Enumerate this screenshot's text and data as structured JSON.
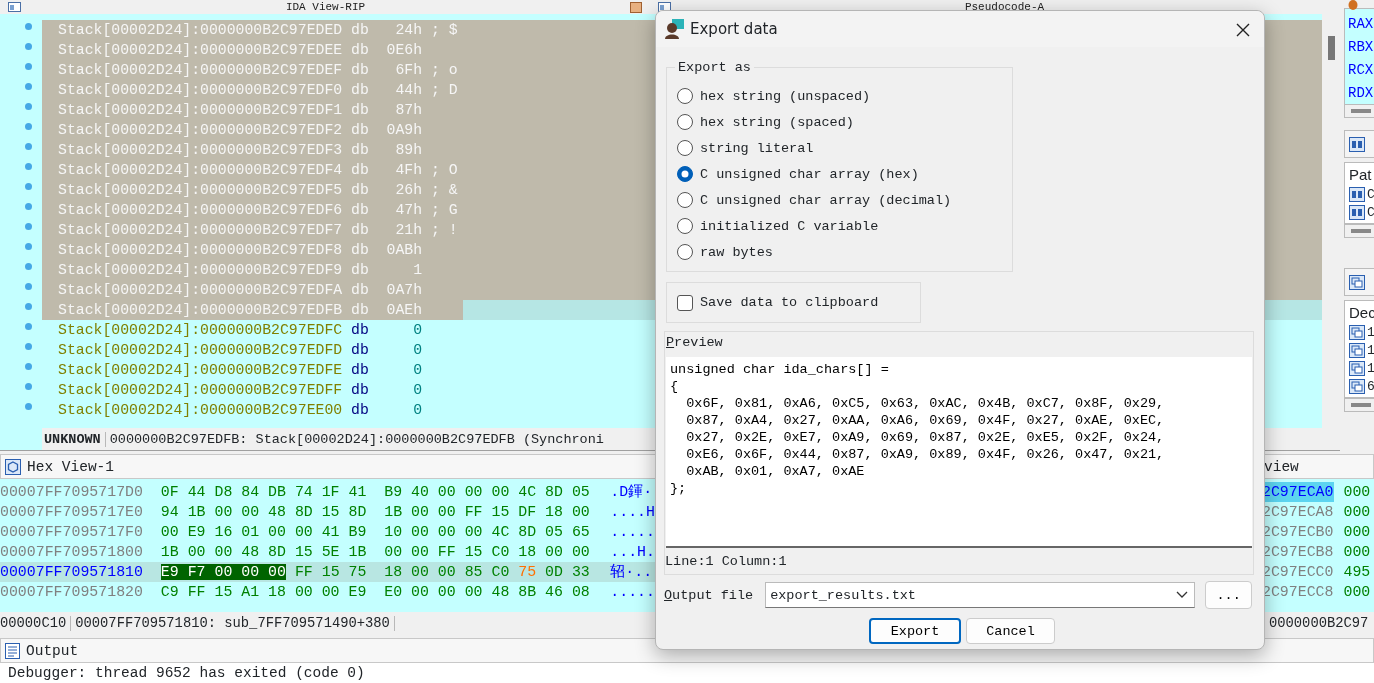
{
  "ida_view": {
    "title": "IDA View-RIP",
    "lines": [
      {
        "address": "Stack[00002D24]:0000000B2C97EDED",
        "op": "db",
        "value": "24h",
        "comment": "; $",
        "selected": true,
        "current": false
      },
      {
        "address": "Stack[00002D24]:0000000B2C97EDEE",
        "op": "db",
        "value": "0E6h",
        "selected": true,
        "current": false
      },
      {
        "address": "Stack[00002D24]:0000000B2C97EDEF",
        "op": "db",
        "value": "6Fh",
        "comment": "; o",
        "selected": true,
        "current": false
      },
      {
        "address": "Stack[00002D24]:0000000B2C97EDF0",
        "op": "db",
        "value": "44h",
        "comment": "; D",
        "selected": true,
        "current": false
      },
      {
        "address": "Stack[00002D24]:0000000B2C97EDF1",
        "op": "db",
        "value": "87h",
        "selected": true,
        "current": false
      },
      {
        "address": "Stack[00002D24]:0000000B2C97EDF2",
        "op": "db",
        "value": "0A9h",
        "selected": true,
        "current": false
      },
      {
        "address": "Stack[00002D24]:0000000B2C97EDF3",
        "op": "db",
        "value": "89h",
        "selected": true,
        "current": false
      },
      {
        "address": "Stack[00002D24]:0000000B2C97EDF4",
        "op": "db",
        "value": "4Fh",
        "comment": "; O",
        "selected": true,
        "current": false
      },
      {
        "address": "Stack[00002D24]:0000000B2C97EDF5",
        "op": "db",
        "value": "26h",
        "comment": "; &",
        "selected": true,
        "current": false
      },
      {
        "address": "Stack[00002D24]:0000000B2C97EDF6",
        "op": "db",
        "value": "47h",
        "comment": "; G",
        "selected": true,
        "current": false
      },
      {
        "address": "Stack[00002D24]:0000000B2C97EDF7",
        "op": "db",
        "value": "21h",
        "comment": "; !",
        "selected": true,
        "current": false
      },
      {
        "address": "Stack[00002D24]:0000000B2C97EDF8",
        "op": "db",
        "value": "0ABh",
        "selected": true,
        "current": false
      },
      {
        "address": "Stack[00002D24]:0000000B2C97EDF9",
        "op": "db",
        "value": "1",
        "selected": true,
        "current": false
      },
      {
        "address": "Stack[00002D24]:0000000B2C97EDFA",
        "op": "db",
        "value": "0A7h",
        "selected": true,
        "current": false
      },
      {
        "address": "Stack[00002D24]:0000000B2C97EDFB",
        "op": "db",
        "value": "0AEh",
        "selected": false,
        "current": true
      },
      {
        "address": "Stack[00002D24]:0000000B2C97EDFC",
        "op": "db",
        "value": "0",
        "selected": false,
        "current": false
      },
      {
        "address": "Stack[00002D24]:0000000B2C97EDFD",
        "op": "db",
        "value": "0",
        "selected": false,
        "current": false
      },
      {
        "address": "Stack[00002D24]:0000000B2C97EDFE",
        "op": "db",
        "value": "0",
        "selected": false,
        "current": false
      },
      {
        "address": "Stack[00002D24]:0000000B2C97EDFF",
        "op": "db",
        "value": "0",
        "selected": false,
        "current": false
      },
      {
        "address": "Stack[00002D24]:0000000B2C97EE00",
        "op": "db",
        "value": "0",
        "selected": false,
        "current": false
      }
    ],
    "status_kind": "UNKNOWN",
    "status_text": "0000000B2C97EDFB: Stack[00002D24]:0000000B2C97EDFB (Synchroni"
  },
  "pseudocode_tab": {
    "title": "Pseudocode-A"
  },
  "right_panels": {
    "registers": [
      "RAX",
      "RBX",
      "RCX",
      "RDX"
    ],
    "panel_2": {
      "header": "Pat",
      "items": [
        "C",
        "C"
      ]
    },
    "panel_3": {
      "header": "Dec",
      "items": [
        "1",
        "1",
        "1",
        "6"
      ]
    }
  },
  "hex_view": {
    "title": "Hex View-1",
    "rows": [
      {
        "address": "00007FF7095717D0",
        "selected": false,
        "ascii": ".D鍕·",
        "bytes": [
          {
            "text": "0F",
            "kind": "plain"
          },
          {
            "text": "44",
            "kind": "plain"
          },
          {
            "text": "D8",
            "kind": "plain"
          },
          {
            "text": "84",
            "kind": "plain"
          },
          {
            "text": "DB",
            "kind": "plain"
          },
          {
            "text": "74",
            "kind": "plain"
          },
          {
            "text": "1F",
            "kind": "plain"
          },
          {
            "text": "41",
            "kind": "plain"
          },
          {
            "text": "B9",
            "kind": "plain"
          },
          {
            "text": "40",
            "kind": "plain"
          },
          {
            "text": "00",
            "kind": "plain"
          },
          {
            "text": "00",
            "kind": "plain"
          },
          {
            "text": "00",
            "kind": "plain"
          },
          {
            "text": "4C",
            "kind": "plain"
          },
          {
            "text": "8D",
            "kind": "plain"
          },
          {
            "text": "05",
            "kind": "plain"
          }
        ]
      },
      {
        "address": "00007FF7095717E0",
        "selected": false,
        "ascii": "....H",
        "bytes": [
          {
            "text": "94",
            "kind": "plain"
          },
          {
            "text": "1B",
            "kind": "plain"
          },
          {
            "text": "00",
            "kind": "plain"
          },
          {
            "text": "00",
            "kind": "plain"
          },
          {
            "text": "48",
            "kind": "plain"
          },
          {
            "text": "8D",
            "kind": "plain"
          },
          {
            "text": "15",
            "kind": "plain"
          },
          {
            "text": "8D",
            "kind": "plain"
          },
          {
            "text": "1B",
            "kind": "plain"
          },
          {
            "text": "00",
            "kind": "plain"
          },
          {
            "text": "00",
            "kind": "plain"
          },
          {
            "text": "FF",
            "kind": "plain"
          },
          {
            "text": "15",
            "kind": "plain"
          },
          {
            "text": "DF",
            "kind": "plain"
          },
          {
            "text": "18",
            "kind": "plain"
          },
          {
            "text": "00",
            "kind": "plain"
          }
        ]
      },
      {
        "address": "00007FF7095717F0",
        "selected": false,
        "ascii": ".....",
        "bytes": [
          {
            "text": "00",
            "kind": "plain"
          },
          {
            "text": "E9",
            "kind": "plain"
          },
          {
            "text": "16",
            "kind": "plain"
          },
          {
            "text": "01",
            "kind": "plain"
          },
          {
            "text": "00",
            "kind": "plain"
          },
          {
            "text": "00",
            "kind": "plain"
          },
          {
            "text": "41",
            "kind": "plain"
          },
          {
            "text": "B9",
            "kind": "plain"
          },
          {
            "text": "10",
            "kind": "plain"
          },
          {
            "text": "00",
            "kind": "plain"
          },
          {
            "text": "00",
            "kind": "plain"
          },
          {
            "text": "00",
            "kind": "plain"
          },
          {
            "text": "4C",
            "kind": "plain"
          },
          {
            "text": "8D",
            "kind": "plain"
          },
          {
            "text": "05",
            "kind": "plain"
          },
          {
            "text": "65",
            "kind": "plain"
          }
        ]
      },
      {
        "address": "00007FF709571800",
        "selected": false,
        "ascii": "...H.",
        "bytes": [
          {
            "text": "1B",
            "kind": "plain"
          },
          {
            "text": "00",
            "kind": "plain"
          },
          {
            "text": "00",
            "kind": "plain"
          },
          {
            "text": "48",
            "kind": "plain"
          },
          {
            "text": "8D",
            "kind": "plain"
          },
          {
            "text": "15",
            "kind": "plain"
          },
          {
            "text": "5E",
            "kind": "plain"
          },
          {
            "text": "1B",
            "kind": "plain"
          },
          {
            "text": "00",
            "kind": "plain"
          },
          {
            "text": "00",
            "kind": "plain"
          },
          {
            "text": "FF",
            "kind": "plain"
          },
          {
            "text": "15",
            "kind": "plain"
          },
          {
            "text": "C0",
            "kind": "plain"
          },
          {
            "text": "18",
            "kind": "plain"
          },
          {
            "text": "00",
            "kind": "plain"
          },
          {
            "text": "00",
            "kind": "plain"
          }
        ]
      },
      {
        "address": "00007FF709571810",
        "selected": true,
        "ascii": "轺·..",
        "bytes": [
          {
            "text": "E9",
            "kind": "selected"
          },
          {
            "text": "F7",
            "kind": "selected"
          },
          {
            "text": "00",
            "kind": "selected"
          },
          {
            "text": "00",
            "kind": "selected"
          },
          {
            "text": "00",
            "kind": "selected"
          },
          {
            "text": "FF",
            "kind": "plain"
          },
          {
            "text": "15",
            "kind": "plain"
          },
          {
            "text": "75",
            "kind": "plain"
          },
          {
            "text": "18",
            "kind": "plain"
          },
          {
            "text": "00",
            "kind": "plain"
          },
          {
            "text": "00",
            "kind": "plain"
          },
          {
            "text": "85",
            "kind": "plain"
          },
          {
            "text": "C0",
            "kind": "plain"
          },
          {
            "text": "75",
            "kind": "changed"
          },
          {
            "text": "0D",
            "kind": "plain"
          },
          {
            "text": "33",
            "kind": "plain"
          }
        ]
      },
      {
        "address": "00007FF709571820",
        "selected": false,
        "ascii": ".....",
        "bytes": [
          {
            "text": "C9",
            "kind": "plain"
          },
          {
            "text": "FF",
            "kind": "plain"
          },
          {
            "text": "15",
            "kind": "plain"
          },
          {
            "text": "A1",
            "kind": "plain"
          },
          {
            "text": "18",
            "kind": "plain"
          },
          {
            "text": "00",
            "kind": "plain"
          },
          {
            "text": "00",
            "kind": "plain"
          },
          {
            "text": "E9",
            "kind": "plain"
          },
          {
            "text": "E0",
            "kind": "plain"
          },
          {
            "text": "00",
            "kind": "plain"
          },
          {
            "text": "00",
            "kind": "plain"
          },
          {
            "text": "00",
            "kind": "plain"
          },
          {
            "text": "48",
            "kind": "plain"
          },
          {
            "text": "8B",
            "kind": "plain"
          },
          {
            "text": "46",
            "kind": "plain"
          },
          {
            "text": "08",
            "kind": "plain"
          }
        ]
      }
    ],
    "status_offset": "00000C10",
    "status_text": "00007FF709571810: sub_7FF709571490+380"
  },
  "hex_view_2": {
    "title": "view",
    "rows": [
      {
        "address": "2C97ECA0",
        "value": "000",
        "selected": true
      },
      {
        "address": "2C97ECA8",
        "value": "000",
        "selected": false
      },
      {
        "address": "2C97ECB0",
        "value": "000",
        "selected": false
      },
      {
        "address": "2C97ECB8",
        "value": "000",
        "selected": false
      },
      {
        "address": "2C97ECC0",
        "value": "495",
        "selected": false
      },
      {
        "address": "2C97ECC8",
        "value": "000",
        "selected": false
      }
    ],
    "status_text": "0000000B2C97"
  },
  "output": {
    "title": "Output",
    "lines": [
      "Debugger: thread 9652 has exited (code 0)"
    ]
  },
  "export_dialog": {
    "title": "Export data",
    "group_label": "Export as",
    "formats": [
      {
        "label": "hex string (unspaced)",
        "selected": false
      },
      {
        "label": "hex string (spaced)",
        "selected": false
      },
      {
        "label": "string literal",
        "selected": false
      },
      {
        "label": "C unsigned char array (hex)",
        "selected": true
      },
      {
        "label": "C unsigned char array (decimal)",
        "selected": false
      },
      {
        "label": "initialized C variable",
        "selected": false
      },
      {
        "label": "raw bytes",
        "selected": false
      }
    ],
    "clipboard": {
      "label": "Save data to clipboard",
      "checked": false
    },
    "preview": {
      "label": "Preview",
      "lines": [
        "unsigned char ida_chars[] =",
        "{",
        "  0x6F, 0x81, 0xA6, 0xC5, 0x63, 0xAC, 0x4B, 0xC7, 0x8F, 0x29,",
        "  0x87, 0xA4, 0x27, 0xAA, 0xA6, 0x69, 0x4F, 0x27, 0xAE, 0xEC,",
        "  0x27, 0x2E, 0xE7, 0xA9, 0x69, 0x87, 0x2E, 0xE5, 0x2F, 0x24,",
        "  0xE6, 0x6F, 0x44, 0x87, 0xA9, 0x89, 0x4F, 0x26, 0x47, 0x21,",
        "  0xAB, 0x01, 0xA7, 0xAE",
        "};"
      ],
      "status": "Line:1  Column:1"
    },
    "output_file": {
      "label": "Output file",
      "value": "export_results.txt"
    },
    "browse_button": "...",
    "buttons": [
      {
        "label": "Export",
        "default": true
      },
      {
        "label": "Cancel",
        "default": false
      }
    ]
  }
}
